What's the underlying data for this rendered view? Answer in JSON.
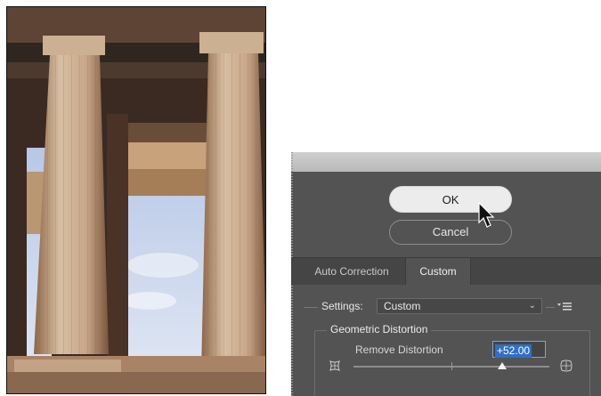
{
  "photo": {
    "subject": "temple-columns-photo"
  },
  "dialog": {
    "ok_label": "OK",
    "cancel_label": "Cancel",
    "tabs": [
      {
        "label": "Auto Correction",
        "active": false
      },
      {
        "label": "Custom",
        "active": true
      }
    ],
    "settings": {
      "label": "Settings:",
      "value": "Custom"
    },
    "geometric_distortion": {
      "title": "Geometric Distortion",
      "remove_distortion": {
        "label": "Remove Distortion",
        "value": "+52.00",
        "slider_fraction": 0.76
      }
    }
  },
  "colors": {
    "panel_bg": "#535353",
    "tab_bar_bg": "#454545",
    "selection_blue": "#2f6fc7"
  },
  "icons": [
    "mouse-pointer",
    "panel-menu",
    "pincushion-distortion",
    "barrel-distortion"
  ]
}
